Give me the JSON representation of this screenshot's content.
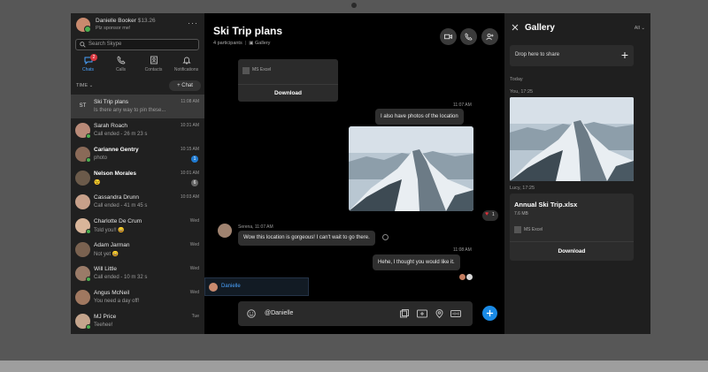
{
  "profile": {
    "name": "Danielle Booker",
    "credit": "$13.26",
    "mood": "Plz sponsor me!"
  },
  "search": {
    "placeholder": "Search Skype"
  },
  "nav": [
    {
      "label": "Chats",
      "badge": "2",
      "icon": "chat-icon"
    },
    {
      "label": "Calls",
      "icon": "phone-icon"
    },
    {
      "label": "Contacts",
      "icon": "contacts-icon"
    },
    {
      "label": "Notifications",
      "icon": "bell-icon"
    }
  ],
  "sort_label": "TIME",
  "new_chat_label": "+ Chat",
  "chats": [
    {
      "name": "Ski Trip plans",
      "sub": "Is there any way to pin these...",
      "time": "11:08 AM",
      "initials": "ST",
      "avatar": "#3a3a3a",
      "active": true
    },
    {
      "name": "Sarah Roach",
      "sub": "Call ended - 26 m 23 s",
      "time": "10:31 AM",
      "avatar": "#b98a78",
      "status": "#4caf50"
    },
    {
      "name": "Carianne Gentry",
      "sub": "photo",
      "time": "10:15 AM",
      "count": "1",
      "avatar": "#8a6a58",
      "status": "#4caf50",
      "bold": true
    },
    {
      "name": "Nelson Morales",
      "sub": "😉",
      "time": "10:01 AM",
      "count": "6",
      "countGrey": true,
      "avatar": "#6b5a4a",
      "bold": true
    },
    {
      "name": "Cassandra Drunn",
      "sub": "Call ended - 41 m 45 s",
      "time": "10:03 AM",
      "avatar": "#c7a08a"
    },
    {
      "name": "Charlotte De Crum",
      "sub": "Told you!! 😄",
      "time": "Wed",
      "avatar": "#d9b59a",
      "status": "#4caf50"
    },
    {
      "name": "Adam Jarman",
      "sub": "Not yet 😄",
      "time": "Wed",
      "avatar": "#7a6250"
    },
    {
      "name": "Will Little",
      "sub": "Call ended - 10 m 32 s",
      "time": "Wed",
      "avatar": "#9a7b68",
      "status": "#4caf50"
    },
    {
      "name": "Angus McNeil",
      "sub": "You need a day off!",
      "time": "Wed",
      "avatar": "#a07860"
    },
    {
      "name": "MJ Price",
      "sub": "Teehee!",
      "time": "Tue",
      "avatar": "#c4a48c",
      "status": "#4caf50"
    }
  ],
  "conversation": {
    "title": "Ski Trip plans",
    "participants": "4 participants",
    "gallery_link": "Gallery",
    "file_card": {
      "type": "MS Excel",
      "download": "Download"
    },
    "messages": {
      "t1": "11:07 AM",
      "m1": "I also have photos of the location",
      "serena_meta": "Serena, 11:07 AM",
      "m2": "Wow this location is gorgeous! I can't wait to go there.",
      "t2": "11:08 AM",
      "m3": "Hehe, I thought you would like it.",
      "reaction_count": "1"
    },
    "mention": "Danielle",
    "compose_text": "@Danielle"
  },
  "gallery": {
    "title": "Gallery",
    "filter": "All",
    "drop_text": "Drop here to share",
    "today": "Today",
    "photo_meta": "You, 17:25",
    "file_meta": "Lucy, 17:25",
    "file": {
      "name": "Annual Ski Trip.xlsx",
      "size": "7.6 MB",
      "type": "MS Excel",
      "download": "Download"
    }
  },
  "colors": {
    "accent": "#1a8ae5",
    "badge": "#d9363e",
    "online": "#4caf50"
  }
}
